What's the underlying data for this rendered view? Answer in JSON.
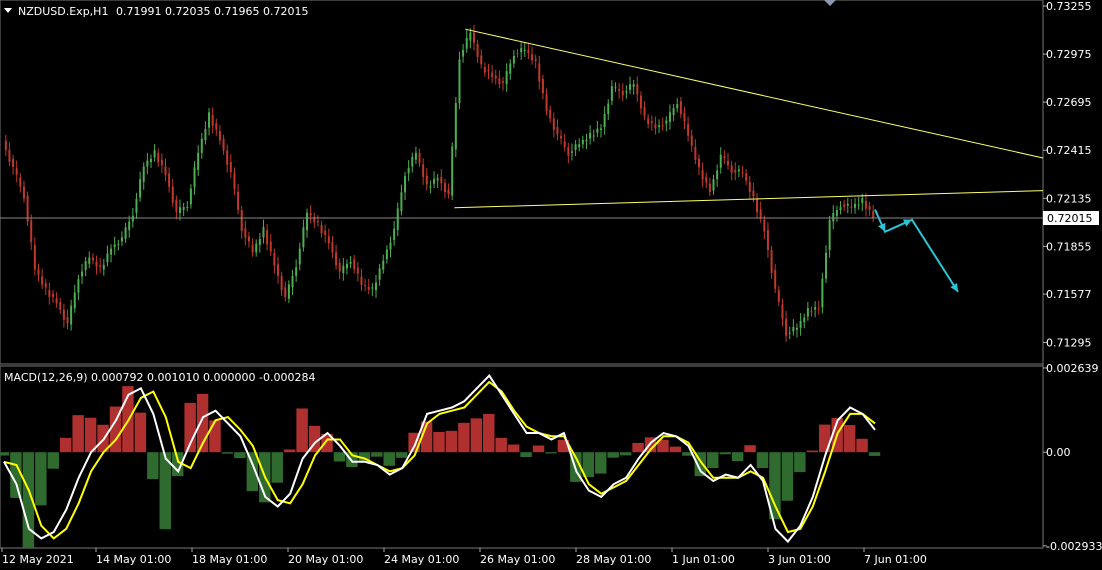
{
  "header": {
    "symbol": "NZDUSD.Exp,H1",
    "ohlc": "0.71991 0.72035 0.71965 0.72015",
    "current_price": "0.72015"
  },
  "macd_header": {
    "label": "MACD(12,26,9) 0.000792 0.001010 0.000000 -0.000284"
  },
  "colors": {
    "background": "#000000",
    "bull": "#4caf50",
    "bear": "#c0392b",
    "trendline": "#ffff66",
    "arrow": "#29c5d8",
    "macd_line": "#ffffff",
    "signal_line": "#ffff00"
  },
  "chart_data": [
    {
      "type": "line",
      "title": "NZDUSD.Exp,H1",
      "ylim": [
        0.7117,
        0.7329
      ],
      "y_ticks": [
        "0.73255",
        "0.72975",
        "0.72695",
        "0.72415",
        "0.72135",
        "0.71855",
        "0.71577",
        "0.71295"
      ],
      "x_ticks": [
        "12 May 2021",
        "14 May 01:00",
        "18 May 01:00",
        "20 May 01:00",
        "24 May 01:00",
        "26 May 01:00",
        "28 May 01:00",
        "1 Jun 01:00",
        "3 Jun 01:00",
        "7 Jun 01:00"
      ],
      "series": [
        {
          "values": [
            0.7247,
            0.7231,
            0.7215,
            0.7172,
            0.716,
            0.7153,
            0.714,
            0.7168,
            0.7179,
            0.7172,
            0.7185,
            0.719,
            0.7205,
            0.7232,
            0.724,
            0.7228,
            0.7205,
            0.721,
            0.724,
            0.7262,
            0.7248,
            0.7228,
            0.7196,
            0.7182,
            0.7195,
            0.7175,
            0.7155,
            0.7175,
            0.7205,
            0.7198,
            0.7188,
            0.717,
            0.7178,
            0.7163,
            0.716,
            0.7178,
            0.7195,
            0.7228,
            0.724,
            0.722,
            0.7226,
            0.7215,
            0.7296,
            0.731,
            0.729,
            0.7285,
            0.728,
            0.7298,
            0.73,
            0.7292,
            0.7265,
            0.725,
            0.724,
            0.7245,
            0.725,
            0.7255,
            0.7278,
            0.7275,
            0.728,
            0.726,
            0.7255,
            0.7258,
            0.727,
            0.725,
            0.723,
            0.7218,
            0.7238,
            0.723,
            0.7228,
            0.7213,
            0.7195,
            0.716,
            0.7135,
            0.7138,
            0.7148,
            0.715,
            0.72,
            0.721,
            0.7208,
            0.7212,
            0.7203
          ],
          "extra": {
            "last_close": "0.72015"
          }
        }
      ],
      "annotations": [
        "descending trendline",
        "horizontal support line",
        "projection arrows"
      ]
    },
    {
      "type": "bar",
      "title": "MACD(12,26,9)",
      "ylim": [
        -0.003,
        0.0027
      ],
      "y_ticks": [
        "0.002639",
        "0.00",
        "-0.002933"
      ],
      "series": [
        {
          "name": "MACD",
          "values": [
            -0.0003,
            -0.001,
            -0.0024,
            -0.0027,
            -0.0025,
            -0.0018,
            -0.0008,
            0.0,
            0.0004,
            0.001,
            0.0018,
            0.002,
            0.0012,
            -0.0002,
            -0.0006,
            0.0003,
            0.0011,
            0.0013,
            0.0009,
            0.0005,
            -0.0004,
            -0.0014,
            -0.0017,
            -0.0013,
            -0.0002,
            0.0003,
            0.0006,
            0.0002,
            -0.0003,
            -0.0003,
            -0.0004,
            -0.0007,
            -0.0005,
            0.0002,
            0.0012,
            0.0013,
            0.0014,
            0.0016,
            0.002,
            0.0024,
            0.0018,
            0.0012,
            0.0006,
            0.0006,
            0.0004,
            0.0006,
            -0.0006,
            -0.0012,
            -0.0014,
            -0.001,
            -0.0008,
            -0.0002,
            0.0003,
            0.0006,
            0.0005,
            0.0002,
            -0.0006,
            -0.0009,
            -0.0007,
            -0.0008,
            -0.0004,
            -0.0009,
            -0.0024,
            -0.0028,
            -0.0023,
            -0.0014,
            -0.0001,
            0.001,
            0.0014,
            0.0012,
            0.0007
          ]
        },
        {
          "name": "Signal",
          "values": [
            -0.0003,
            -0.0004,
            -0.0012,
            -0.0023,
            -0.0027,
            -0.0024,
            -0.0016,
            -0.0006,
            0.0,
            0.0004,
            0.001,
            0.0017,
            0.0019,
            0.0011,
            -0.0003,
            -0.0005,
            0.0003,
            0.001,
            0.0011,
            0.0007,
            0.0002,
            -0.0008,
            -0.0015,
            -0.0016,
            -0.001,
            -0.0001,
            0.0004,
            0.0004,
            -0.0001,
            -0.0002,
            -0.0004,
            -0.0006,
            -0.0005,
            -0.0001,
            0.0009,
            0.0012,
            0.0013,
            0.0014,
            0.0018,
            0.0022,
            0.0019,
            0.0013,
            0.0008,
            0.0006,
            0.0005,
            0.0005,
            -0.0002,
            -0.001,
            -0.0013,
            -0.0011,
            -0.0009,
            -0.0004,
            0.0001,
            0.0005,
            0.0005,
            0.0003,
            -0.0003,
            -0.0008,
            -0.0008,
            -0.0008,
            -0.0006,
            -0.0008,
            -0.0017,
            -0.0025,
            -0.0024,
            -0.0017,
            -0.0006,
            0.0006,
            0.0012,
            0.0012,
            0.0009
          ]
        }
      ]
    }
  ]
}
